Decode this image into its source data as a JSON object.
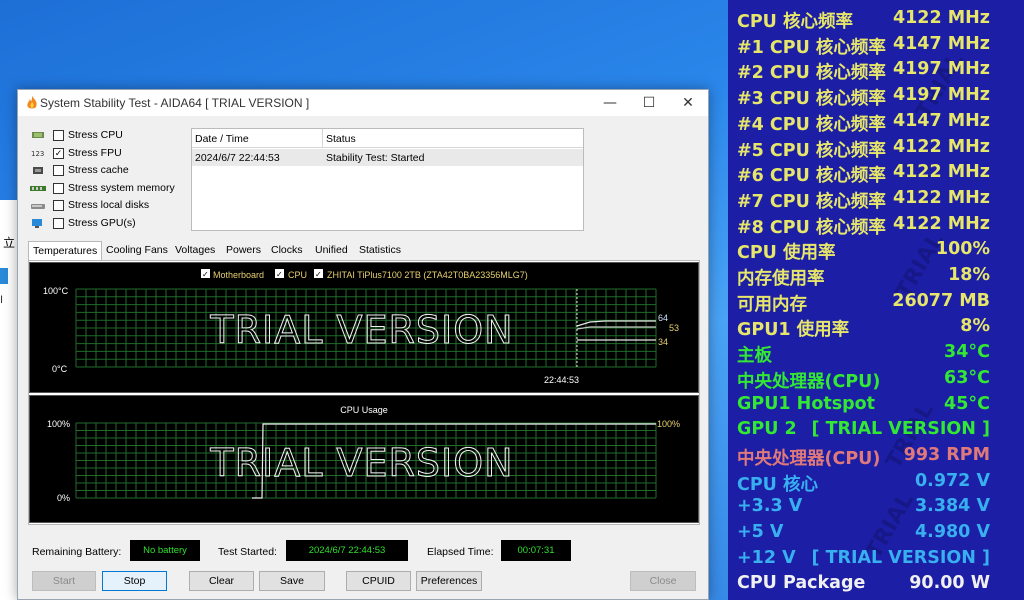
{
  "background_window": {
    "text": "立",
    "pipe": "I"
  },
  "window": {
    "title": "System Stability Test - AIDA64  [ TRIAL VERSION ]",
    "minimize": "—",
    "maximize": "☐",
    "close": "✕"
  },
  "stress_options": [
    {
      "label": "Stress CPU",
      "checked": false,
      "icon": "cpu-chip-icon"
    },
    {
      "label": "Stress FPU",
      "checked": true,
      "icon": "fpu-icon"
    },
    {
      "label": "Stress cache",
      "checked": false,
      "icon": "cache-icon"
    },
    {
      "label": "Stress system memory",
      "checked": false,
      "icon": "memory-icon"
    },
    {
      "label": "Stress local disks",
      "checked": false,
      "icon": "disk-icon"
    },
    {
      "label": "Stress GPU(s)",
      "checked": false,
      "icon": "gpu-monitor-icon"
    }
  ],
  "log": {
    "col_datetime": "Date / Time",
    "col_status": "Status",
    "rows": [
      {
        "datetime": "2024/6/7 22:44:53",
        "status": "Stability Test: Started"
      }
    ]
  },
  "tabs": [
    {
      "label": "Temperatures",
      "active": true
    },
    {
      "label": "Cooling Fans",
      "active": false
    },
    {
      "label": "Voltages",
      "active": false
    },
    {
      "label": "Powers",
      "active": false
    },
    {
      "label": "Clocks",
      "active": false
    },
    {
      "label": "Unified",
      "active": false
    },
    {
      "label": "Statistics",
      "active": false
    }
  ],
  "temp_graph": {
    "legend": [
      {
        "label": "Motherboard",
        "checked": true,
        "color": "#e8d070"
      },
      {
        "label": "CPU",
        "checked": true,
        "color": "#e8d070"
      },
      {
        "label": "ZHITAI TiPlus7100 2TB (ZTA42T0BA23356MLG7)",
        "checked": true,
        "color": "#e8d070"
      }
    ],
    "ymax_label": "100°C",
    "ymin_label": "0°C",
    "time_label": "22:44:53",
    "watermark": "TRIAL VERSION",
    "value_labels": {
      "v64": "64",
      "v53": "53",
      "v34": "34"
    }
  },
  "cpu_graph": {
    "title": "CPU Usage",
    "ymax_label": "100%",
    "ymin_label": "0%",
    "current_label": "100%",
    "watermark": "TRIAL VERSION"
  },
  "status": {
    "battery_label": "Remaining Battery:",
    "battery_value": "No battery",
    "started_label": "Test Started:",
    "started_value": "2024/6/7 22:44:53",
    "elapsed_label": "Elapsed Time:",
    "elapsed_value": "00:07:31"
  },
  "buttons": {
    "start": "Start",
    "stop": "Stop",
    "clear": "Clear",
    "save": "Save",
    "cpuid": "CPUID",
    "preferences": "Preferences",
    "close": "Close"
  },
  "osd": {
    "background": "#1c1ea6",
    "rows": [
      {
        "label": "CPU 核心频率",
        "value": "4122 MHz",
        "color": "#e6e66a"
      },
      {
        "label": "#1 CPU 核心频率",
        "value": "4147 MHz",
        "color": "#e6e66a"
      },
      {
        "label": "#2 CPU 核心频率",
        "value": "4197 MHz",
        "color": "#e6e66a"
      },
      {
        "label": "#3 CPU 核心频率",
        "value": "4197 MHz",
        "color": "#e6e66a"
      },
      {
        "label": "#4 CPU 核心频率",
        "value": "4147 MHz",
        "color": "#e6e66a"
      },
      {
        "label": "#5 CPU 核心频率",
        "value": "4122 MHz",
        "color": "#e6e66a"
      },
      {
        "label": "#6 CPU 核心频率",
        "value": "4122 MHz",
        "color": "#e6e66a"
      },
      {
        "label": "#7 CPU 核心频率",
        "value": "4122 MHz",
        "color": "#e6e66a"
      },
      {
        "label": "#8 CPU 核心频率",
        "value": "4122 MHz",
        "color": "#e6e66a"
      },
      {
        "label": "CPU 使用率",
        "value": "100%",
        "color": "#e6e66a"
      },
      {
        "label": "内存使用率",
        "value": "18%",
        "color": "#e6e66a"
      },
      {
        "label": "可用内存",
        "value": "26077 MB",
        "color": "#e6e66a"
      },
      {
        "label": "GPU1 使用率",
        "value": "8%",
        "color": "#e6e66a"
      },
      {
        "label": "主板",
        "value": "34°C",
        "color": "#33e833"
      },
      {
        "label": "中央处理器(CPU)",
        "value": "63°C",
        "color": "#33e833"
      },
      {
        "label": "GPU1 Hotspot",
        "value": "45°C",
        "color": "#33e833"
      },
      {
        "label": "GPU 2",
        "value": "[ TRIAL VERSION ]",
        "color": "#33e833"
      },
      {
        "label": "中央处理器(CPU)",
        "value": "993 RPM",
        "color": "#e07a7a"
      },
      {
        "label": "CPU 核心",
        "value": "0.972 V",
        "color": "#38b0f0"
      },
      {
        "label": "+3.3 V",
        "value": "3.384 V",
        "color": "#38b0f0"
      },
      {
        "label": "+5 V",
        "value": "4.980 V",
        "color": "#38b0f0"
      },
      {
        "label": "+12 V",
        "value": "[ TRIAL VERSION ]",
        "color": "#38b0f0"
      },
      {
        "label": "CPU Package",
        "value": "90.00 W",
        "color": "#f0f0f0"
      }
    ]
  }
}
